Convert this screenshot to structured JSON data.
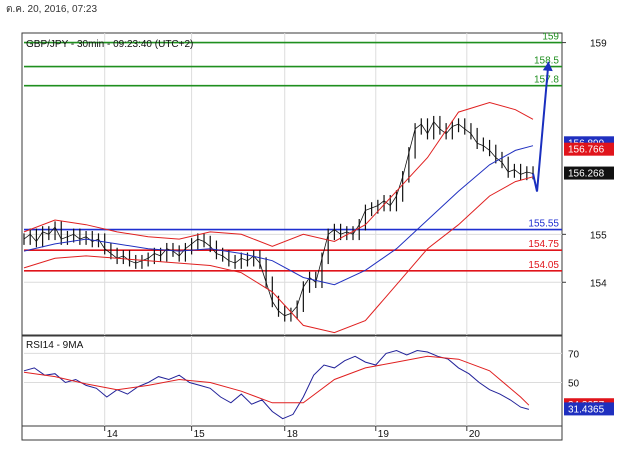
{
  "header": {
    "date_label": "ต.ค. 20, 2016, 07:23"
  },
  "colors": {
    "background": "#ffffff",
    "frame": "#3a3a3a",
    "grid": "#dcdcdc",
    "resistance": "#1f8f1f",
    "support_blue": "#1f2fd0",
    "support_red": "#e0141b",
    "bollinger": "#e02020",
    "ma": "#2030c0",
    "price": "#111111",
    "projection": "#1a2fbf",
    "price_tag_bid": "#1f2fbf",
    "price_tag_ask": "#e0141b",
    "price_tag_current": "#111111",
    "rsi_line": "#222299",
    "rsi_ma": "#e02020"
  },
  "chart_data": [
    {
      "type": "candlestick",
      "title": "GBP/JPY - 30min - 09:23:40 (UTC+2)",
      "ylim": [
        152.9,
        159.2
      ],
      "yticks": [
        154,
        155,
        159
      ],
      "xticks": [
        "14",
        "15",
        "18",
        "19",
        "20"
      ],
      "grid": true,
      "price_tags": [
        {
          "label": "156.899",
          "value": 156.899,
          "role": "bid"
        },
        {
          "label": "156.766",
          "value": 156.766,
          "role": "ask"
        },
        {
          "label": "156.268",
          "value": 156.268,
          "role": "current"
        }
      ],
      "levels": [
        {
          "label": "159",
          "value": 159.0,
          "kind": "resistance"
        },
        {
          "label": "158.5",
          "value": 158.5,
          "kind": "resistance"
        },
        {
          "label": "157.8",
          "value": 158.1,
          "kind": "resistance"
        },
        {
          "label": "155.55",
          "value": 155.1,
          "kind": "support"
        },
        {
          "label": "154.75",
          "value": 154.67,
          "kind": "support-red"
        },
        {
          "label": "154.05",
          "value": 154.24,
          "kind": "support-red"
        }
      ],
      "series": [
        {
          "kind": "price",
          "x": [
            0,
            6,
            12,
            18,
            24,
            30,
            36,
            42,
            48,
            54,
            60,
            66,
            72,
            78,
            84,
            90,
            96,
            102,
            108,
            114,
            120,
            126,
            132,
            138,
            144,
            150,
            156,
            162,
            168,
            174,
            180,
            186,
            192,
            198,
            204,
            210,
            216,
            222,
            228,
            234,
            240,
            246,
            252,
            258,
            264,
            270,
            276,
            282,
            288,
            294,
            300,
            306,
            312,
            318,
            324,
            330,
            336,
            342,
            348,
            354,
            360,
            366,
            372,
            378,
            384,
            390,
            396,
            402,
            408,
            414,
            420,
            426,
            432,
            438,
            444,
            450,
            456,
            462,
            468,
            474,
            480,
            486,
            492
          ],
          "values": [
            154.9,
            155.0,
            154.85,
            155.05,
            155.0,
            155.15,
            154.9,
            154.95,
            155.0,
            154.9,
            154.95,
            154.85,
            154.9,
            154.7,
            154.6,
            154.5,
            154.55,
            154.45,
            154.4,
            154.45,
            154.5,
            154.6,
            154.55,
            154.7,
            154.65,
            154.55,
            154.7,
            154.8,
            154.9,
            154.85,
            154.75,
            154.6,
            154.55,
            154.45,
            154.4,
            154.5,
            154.45,
            154.55,
            154.4,
            154.0,
            153.6,
            153.4,
            153.3,
            153.35,
            153.5,
            153.9,
            154.1,
            154.0,
            154.5,
            155.0,
            155.1,
            155.0,
            155.05,
            155.0,
            155.2,
            155.5,
            155.55,
            155.6,
            155.7,
            155.6,
            155.8,
            156.2,
            156.7,
            157.2,
            157.3,
            157.1,
            157.35,
            157.2,
            157.1,
            157.25,
            157.3,
            157.2,
            157.1,
            156.9,
            156.85,
            156.75,
            156.6,
            156.5,
            156.3,
            156.35,
            156.25,
            156.3,
            156.268
          ]
        },
        {
          "kind": "ma",
          "x": [
            0,
            30,
            60,
            90,
            120,
            150,
            180,
            210,
            240,
            270,
            300,
            330,
            360,
            390,
            420,
            450,
            475,
            492
          ],
          "values": [
            154.65,
            154.8,
            154.9,
            154.8,
            154.7,
            154.65,
            154.7,
            154.6,
            154.45,
            154.1,
            153.95,
            154.25,
            154.7,
            155.3,
            155.9,
            156.45,
            156.75,
            156.85
          ]
        },
        {
          "kind": "bollinger-upper",
          "x": [
            0,
            30,
            60,
            90,
            120,
            150,
            180,
            210,
            240,
            270,
            300,
            330,
            360,
            390,
            420,
            450,
            475,
            492
          ],
          "values": [
            155.05,
            155.3,
            155.2,
            155.05,
            154.95,
            154.9,
            155.05,
            155.0,
            154.75,
            155.0,
            154.85,
            155.2,
            155.9,
            156.6,
            157.55,
            157.75,
            157.6,
            157.4
          ]
        },
        {
          "kind": "bollinger-lower",
          "x": [
            0,
            30,
            60,
            90,
            120,
            150,
            180,
            210,
            240,
            270,
            300,
            330,
            360,
            390,
            420,
            450,
            475,
            492
          ],
          "values": [
            154.3,
            154.5,
            154.55,
            154.5,
            154.45,
            154.4,
            154.35,
            154.2,
            153.8,
            153.1,
            152.95,
            153.2,
            153.95,
            154.7,
            155.2,
            155.8,
            156.1,
            156.2
          ]
        },
        {
          "kind": "projection",
          "x": [
            492,
            507
          ],
          "values": [
            156.268,
            158.6
          ]
        }
      ]
    },
    {
      "type": "line",
      "title": "RSI14 - 9MA",
      "ylim": [
        20,
        82
      ],
      "yticks": [
        50,
        70
      ],
      "grid": true,
      "value_tags": [
        {
          "label": "34.3057",
          "value": 34.3057,
          "role": "ma"
        },
        {
          "label": "31.4365",
          "value": 31.4365,
          "role": "rsi"
        }
      ],
      "series": [
        {
          "kind": "rsi",
          "x": [
            0,
            10,
            20,
            30,
            40,
            50,
            60,
            70,
            80,
            90,
            100,
            110,
            120,
            130,
            140,
            150,
            160,
            170,
            180,
            190,
            200,
            210,
            220,
            230,
            240,
            250,
            260,
            270,
            280,
            290,
            300,
            310,
            320,
            330,
            340,
            350,
            360,
            370,
            380,
            390,
            400,
            410,
            420,
            430,
            440,
            450,
            460,
            470,
            480,
            488
          ],
          "values": [
            58,
            60,
            55,
            56,
            50,
            52,
            48,
            46,
            40,
            45,
            42,
            47,
            50,
            54,
            52,
            55,
            50,
            48,
            46,
            40,
            36,
            42,
            35,
            38,
            30,
            25,
            28,
            40,
            55,
            62,
            60,
            65,
            68,
            64,
            62,
            70,
            72,
            69,
            72,
            71,
            68,
            66,
            60,
            56,
            50,
            45,
            42,
            38,
            33,
            31.4365
          ]
        },
        {
          "kind": "rsi-ma",
          "x": [
            0,
            30,
            60,
            90,
            120,
            150,
            180,
            210,
            240,
            270,
            300,
            330,
            360,
            390,
            420,
            450,
            480,
            488
          ],
          "values": [
            57,
            54,
            49,
            45,
            48,
            52,
            50,
            44,
            36,
            36,
            52,
            60,
            64,
            68,
            66,
            58,
            40,
            34.3057
          ]
        }
      ]
    }
  ]
}
